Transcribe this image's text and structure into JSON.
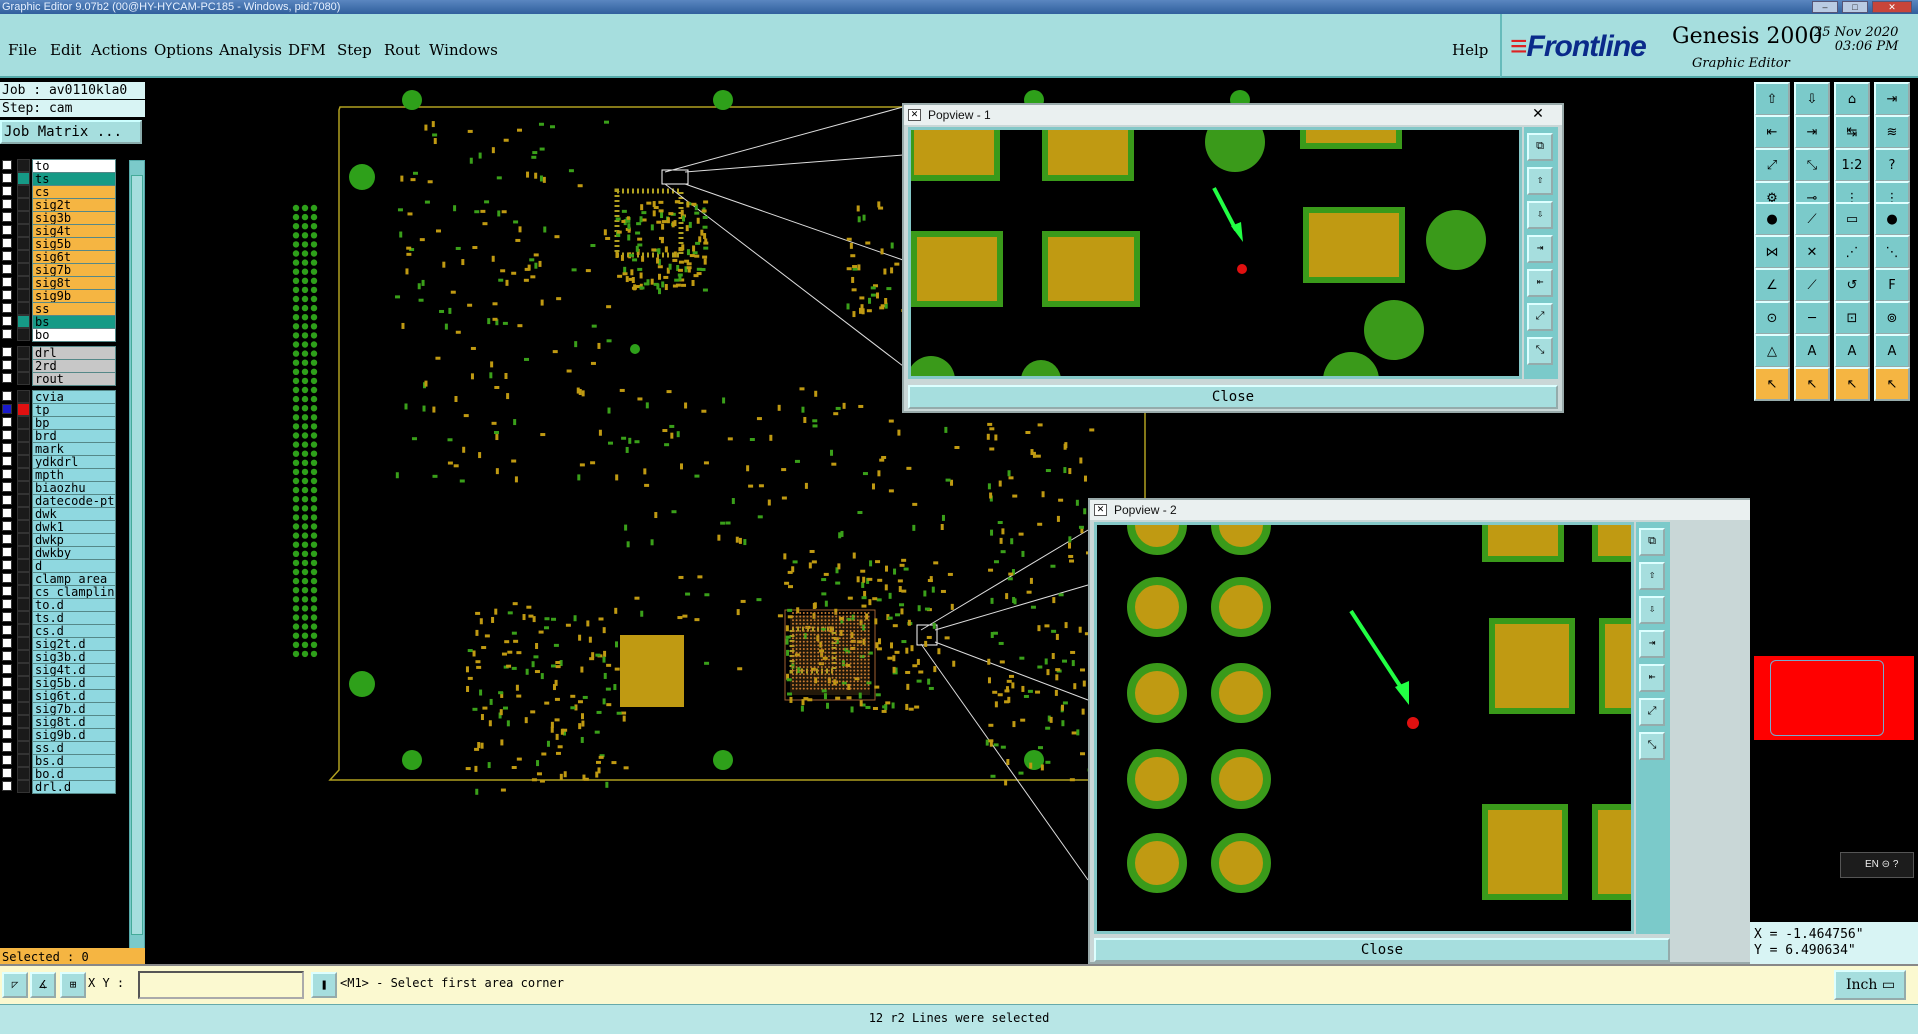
{
  "window": {
    "title": "Graphic Editor 9.07b2 (00@HY-HYCAM-PC185 - Windows, pid:7080)"
  },
  "menubar": {
    "items": [
      {
        "label": "File"
      },
      {
        "label": "Edit"
      },
      {
        "label": "Actions"
      },
      {
        "label": "Options"
      },
      {
        "label": "Analysis"
      },
      {
        "label": "DFM"
      },
      {
        "label": "Step"
      },
      {
        "label": "Rout"
      },
      {
        "label": "Windows"
      }
    ],
    "help": "Help"
  },
  "logo": {
    "brand": "Frontline",
    "product": "Genesis 2000",
    "subtitle": "Graphic Editor",
    "date": "25 Nov 2020",
    "time": "03:06 PM"
  },
  "left": {
    "job": "Job : av0110kla0",
    "step": "Step: cam",
    "job_matrix": "Job Matrix ...",
    "layers": [
      {
        "name": "to",
        "kind": "white"
      },
      {
        "name": "ts",
        "kind": "sel"
      },
      {
        "name": "cs",
        "kind": "board"
      },
      {
        "name": "sig2t",
        "kind": "board"
      },
      {
        "name": "sig3b",
        "kind": "board"
      },
      {
        "name": "sig4t",
        "kind": "board"
      },
      {
        "name": "sig5b",
        "kind": "board"
      },
      {
        "name": "sig6t",
        "kind": "board"
      },
      {
        "name": "sig7b",
        "kind": "board"
      },
      {
        "name": "sig8t",
        "kind": "board"
      },
      {
        "name": "sig9b",
        "kind": "board"
      },
      {
        "name": "ss",
        "kind": "board"
      },
      {
        "name": "bs",
        "kind": "sel"
      },
      {
        "name": "bo",
        "kind": "white"
      },
      {
        "name": "drl",
        "kind": "drill"
      },
      {
        "name": "2rd",
        "kind": "drill"
      },
      {
        "name": "rout",
        "kind": "drill"
      },
      {
        "name": "cvia",
        "kind": "misc"
      },
      {
        "name": "tp",
        "kind": "misc",
        "active": true
      },
      {
        "name": "bp",
        "kind": "misc"
      },
      {
        "name": "brd",
        "kind": "misc"
      },
      {
        "name": "mark",
        "kind": "misc"
      },
      {
        "name": "ydkdrl",
        "kind": "misc"
      },
      {
        "name": "mpth",
        "kind": "misc"
      },
      {
        "name": "biaozhu",
        "kind": "misc"
      },
      {
        "name": "datecode-pt",
        "kind": "misc"
      },
      {
        "name": "dwk",
        "kind": "misc"
      },
      {
        "name": "dwk1",
        "kind": "misc"
      },
      {
        "name": "dwkp",
        "kind": "misc"
      },
      {
        "name": "dwkby",
        "kind": "misc"
      },
      {
        "name": "d",
        "kind": "misc"
      },
      {
        "name": "clamp_area",
        "kind": "misc"
      },
      {
        "name": "cs_clampline",
        "kind": "misc"
      },
      {
        "name": "to.d",
        "kind": "misc"
      },
      {
        "name": "ts.d",
        "kind": "misc"
      },
      {
        "name": "cs.d",
        "kind": "misc"
      },
      {
        "name": "sig2t.d",
        "kind": "misc"
      },
      {
        "name": "sig3b.d",
        "kind": "misc"
      },
      {
        "name": "sig4t.d",
        "kind": "misc"
      },
      {
        "name": "sig5b.d",
        "kind": "misc"
      },
      {
        "name": "sig6t.d",
        "kind": "misc"
      },
      {
        "name": "sig7b.d",
        "kind": "misc"
      },
      {
        "name": "sig8t.d",
        "kind": "misc"
      },
      {
        "name": "sig9b.d",
        "kind": "misc"
      },
      {
        "name": "ss.d",
        "kind": "misc"
      },
      {
        "name": "bs.d",
        "kind": "misc"
      },
      {
        "name": "bo.d",
        "kind": "misc"
      },
      {
        "name": "drl.d",
        "kind": "misc"
      }
    ],
    "selected": "Selected : 0"
  },
  "popview1": {
    "title": "Popview - 1",
    "close": "Close"
  },
  "popview2": {
    "title": "Popview - 2",
    "close": "Close"
  },
  "right": {
    "lang": "EN",
    "x": "X = -1.464756\"",
    "y": "Y = 6.490634\""
  },
  "command": {
    "xy_label": "X Y :",
    "xy_value": "",
    "prompt": "<M1> - Select first area corner",
    "units": "Inch"
  },
  "status": "12 r2 Lines were selected",
  "colors": {
    "accent": "#a6dede",
    "board_layer": "#f5b542",
    "selected_layer": "#169a86",
    "pad_fill": "#c09a12",
    "pad_border": "#3a9a1a",
    "arrow": "#22ff44"
  }
}
